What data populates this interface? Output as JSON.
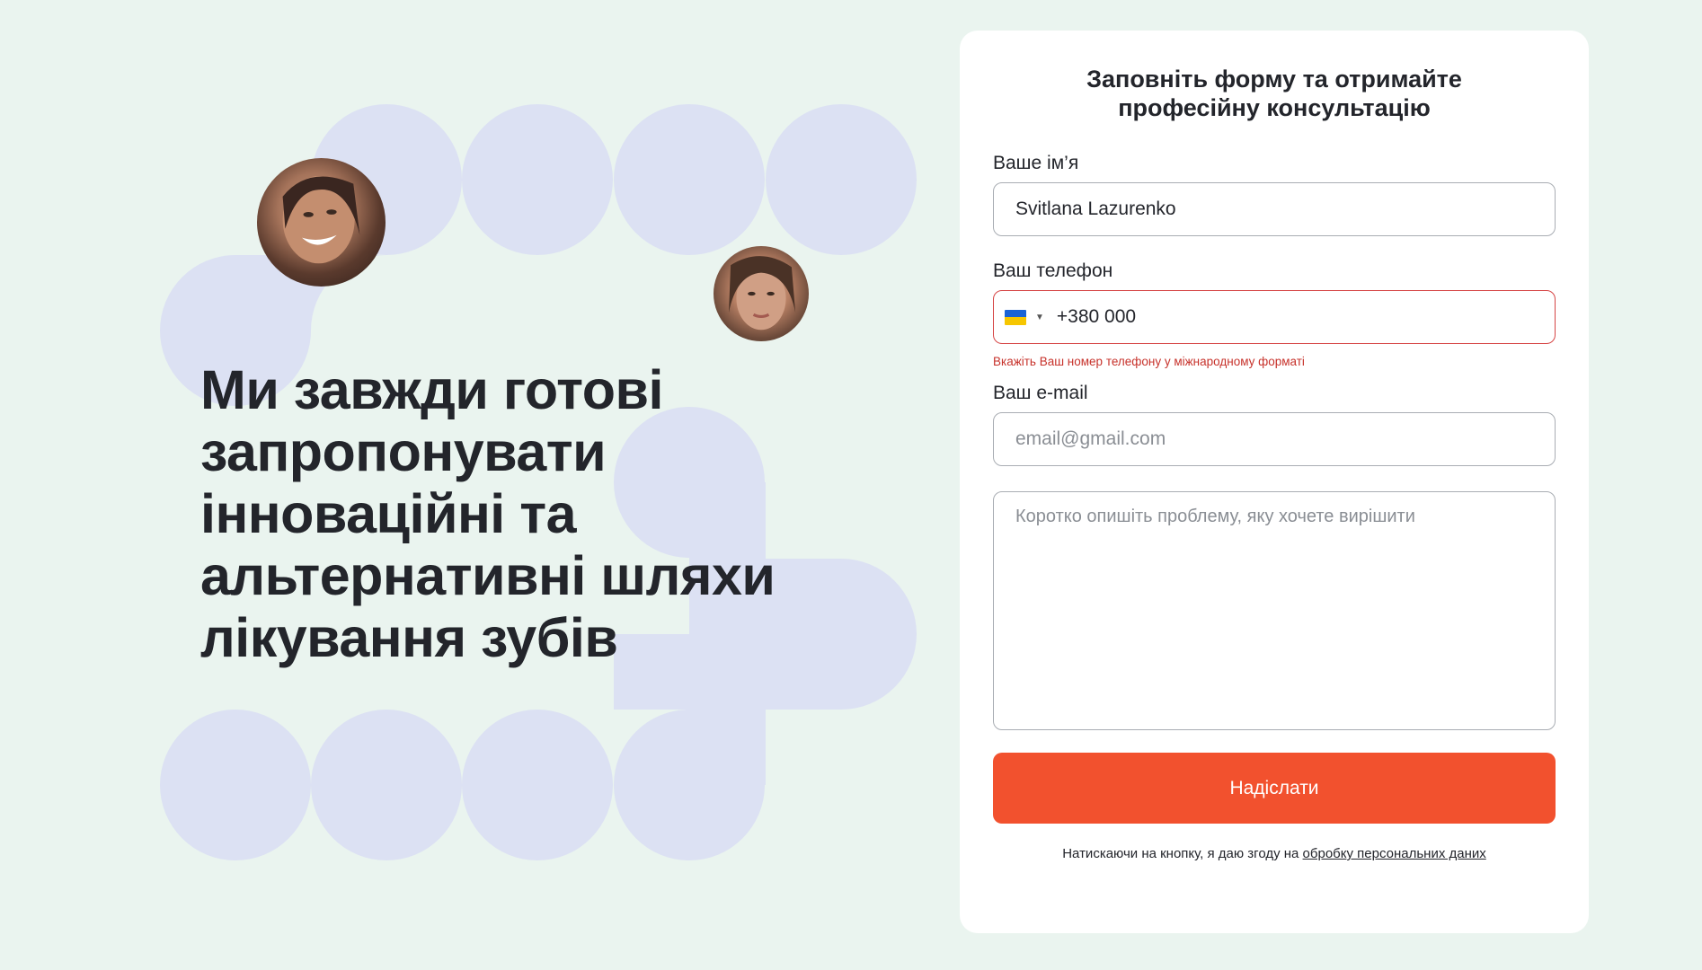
{
  "hero": {
    "headline": "Ми завжди готові запропонувати інноваційні та альтернативні шляхи лікування зубів"
  },
  "form": {
    "title": "Заповніть форму та отримайте професійну консультацію",
    "name": {
      "label": "Ваше ім’я",
      "value": "Svitlana Lazurenko"
    },
    "phone": {
      "label": "Ваш телефон",
      "country_flag": "ukraine-flag-icon",
      "value": "+380 000",
      "error": "Вкажіть Ваш номер телефону у міжнародному форматі"
    },
    "email": {
      "label": "Ваш e-mail",
      "placeholder": "email@gmail.com"
    },
    "message": {
      "placeholder": "Коротко опишіть проблему, яку хочете вирішити"
    },
    "submit_label": "Надіслати",
    "consent_text": "Натискаючи на кнопку, я даю згоду на ",
    "consent_link": "обробку персональних даних"
  },
  "colors": {
    "background": "#eaf4ef",
    "decor_circles": "#dce1f3",
    "accent": "#f2512e",
    "error": "#d64545"
  }
}
